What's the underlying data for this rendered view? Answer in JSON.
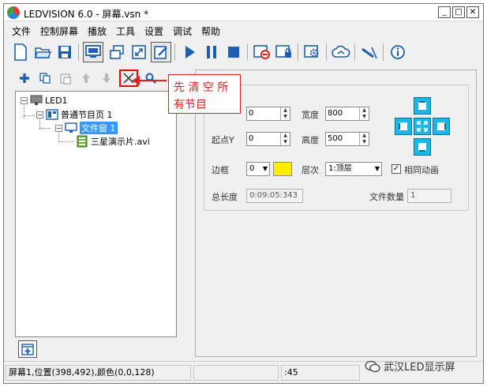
{
  "window": {
    "title": "LEDVISION 6.0 - 屏幕.vsn *"
  },
  "window_controls": {
    "minimize": "_",
    "maximize": "□",
    "close": "✕"
  },
  "menu": [
    "文件",
    "控制屏幕",
    "播放",
    "工具",
    "设置",
    "调试",
    "帮助"
  ],
  "toolbar": {
    "icons": [
      "new-file-icon",
      "open-folder-icon",
      "save-icon",
      "screen-icon",
      "multi-window-icon",
      "fit-icon",
      "edit-icon",
      "play-icon",
      "pause-icon",
      "stop-icon",
      "no-screen-icon",
      "lock-screen-icon",
      "settings-icon",
      "cloud-icon",
      "antenna-icon",
      "info-icon"
    ]
  },
  "tree": {
    "root": "LED1",
    "page": "普通节目页 1",
    "window": "文件窗 1",
    "file": "三星演示片.avi"
  },
  "annotation": {
    "line1": "先 清 空 所",
    "line2": "有节目"
  },
  "properties": {
    "group_title": "性",
    "start_x_value": "0",
    "width_label": "宽度",
    "width_value": "800",
    "start_y_label": "起点Y",
    "start_y_value": "0",
    "height_label": "高度",
    "height_value": "500",
    "border_label": "边框",
    "border_value": "0",
    "layer_label": "层次",
    "layer_value": "1:顶层",
    "sync_anim_label": "相同动画",
    "sync_anim_checked": true,
    "total_length_label": "总长度",
    "total_length_value": "0:09:05:343",
    "file_count_label": "文件数量",
    "file_count_value": "1",
    "border_color": "#ffee00"
  },
  "statusbar": {
    "info": "屏幕1,位置(398,492),颜色(0,0,128)",
    "middle": "",
    "time": ":45"
  },
  "watermark": {
    "text": "武汉LED显示屏"
  },
  "colors": {
    "accent": "#1e5fb4",
    "annotation": "#e02020",
    "selection": "#3399ff",
    "direction": "#19b8e8"
  }
}
